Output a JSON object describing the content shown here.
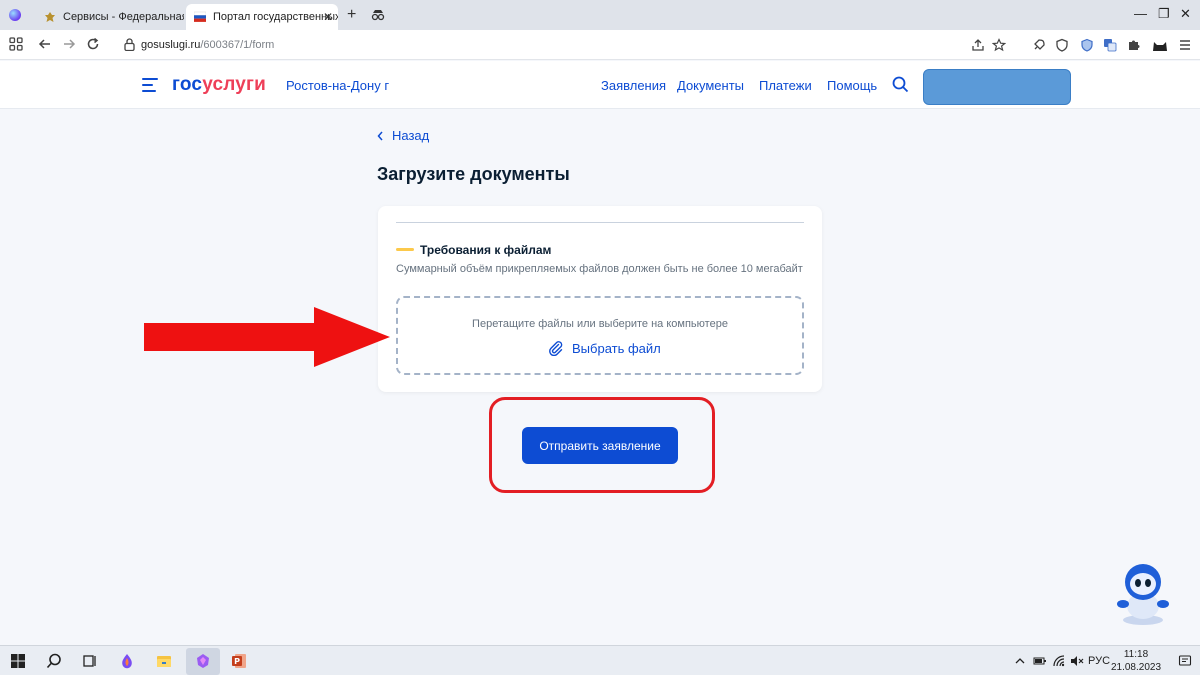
{
  "browser": {
    "tabs": [
      {
        "title": "Сервисы - Федеральная служба"
      },
      {
        "title": "Портал государственных услуг"
      }
    ],
    "tab_close": "✕",
    "new_tab": "+",
    "controls": {
      "minimize": "—",
      "restore": "❐",
      "close": "✕"
    },
    "address": {
      "host": "gosuslugi.ru",
      "path": "/600367/1/form"
    }
  },
  "header": {
    "logo_part1": "гос",
    "logo_part2": "услуги",
    "region": "Ростов-на-Дону г",
    "nav": [
      "Заявления",
      "Документы",
      "Платежи",
      "Помощь"
    ]
  },
  "content": {
    "back_label": "Назад",
    "title": "Загрузите документы",
    "requirements_title": "Требования к файлам",
    "requirements_text": "Суммарный объём прикрепляемых файлов должен быть не более 10 мегабайт",
    "dropzone_text": "Перетащите файлы или выберите на компьютере",
    "choose_file_label": "Выбрать файл",
    "submit_label": "Отправить заявление"
  },
  "taskbar": {
    "language": "РУС",
    "time": "11:18",
    "date": "21.08.2023"
  },
  "colors": {
    "brand_blue": "#0d4cd3",
    "brand_red": "#ee3f58",
    "accent_yellow": "#fcc94b",
    "annotation_red": "#e31e24"
  }
}
